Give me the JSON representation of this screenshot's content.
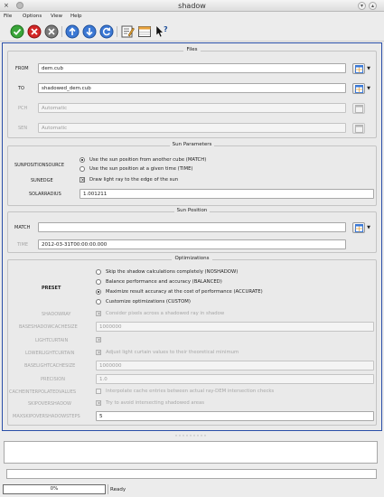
{
  "window": {
    "title": "shadow",
    "close_glyph": "×"
  },
  "menu": [
    "File",
    "Options",
    "View",
    "Help"
  ],
  "toolbar": {
    "icons": [
      "run-icon",
      "stop-icon",
      "reset-icon",
      "upload-icon",
      "download-icon",
      "refresh-icon",
      "edit-icon",
      "table-icon",
      "whats-this-icon"
    ]
  },
  "files": {
    "title": "Files",
    "rows": [
      {
        "label": "FROM",
        "value": "dem.cub",
        "enabled": true
      },
      {
        "label": "TO",
        "value": "shadowed_dem.cub",
        "enabled": true
      },
      {
        "label": "PCH",
        "value": "Automatic",
        "enabled": false
      },
      {
        "label": "SEN",
        "value": "Automatic",
        "enabled": false
      }
    ]
  },
  "sun_parameters": {
    "title": "Sun Parameters",
    "source_label": "SUNPOSITIONSOURCE",
    "source_options": [
      {
        "text": "Use the sun position from another cube (MATCH)",
        "selected": true
      },
      {
        "text": "Use the sun position at a given time (TIME)",
        "selected": false
      }
    ],
    "sunedge_label": "SUNEDGE",
    "sunedge_text": "Draw light ray to the edge of the sun",
    "sunedge_checked": true,
    "solarradius_label": "SOLARRADIUS",
    "solarradius_value": "1.001211"
  },
  "sun_position": {
    "title": "Sun Position",
    "match_label": "MATCH",
    "match_value": "",
    "time_label": "TIME",
    "time_value": "2012-03-31T00:00:00.000"
  },
  "optimizations": {
    "title": "Optimizations",
    "preset_label": "PRESET",
    "preset_options": [
      {
        "text": "Skip the shadow calculations completely (NOSHADOW)",
        "selected": false
      },
      {
        "text": "Balance performance and accuracy (BALANCED)",
        "selected": false
      },
      {
        "text": "Maximize result accuracy at the cost of performance (ACCURATE)",
        "selected": true
      },
      {
        "text": "Customize optimizations (CUSTOM)",
        "selected": false
      }
    ],
    "shadowray": {
      "label": "SHADOWRAY",
      "text": "Consider pixels across a shadowed ray in shadow",
      "checked": true
    },
    "basesize": {
      "label": "BASESHADOWCACHESIZE",
      "value": "1000000"
    },
    "lightcurtain": {
      "label": "LIGHTCURTAIN",
      "text": "",
      "checked": true
    },
    "lowerlight": {
      "label": "LOWERLIGHTCURTAIN",
      "text": "Adjust light curtain values to their theoretical minimum",
      "checked": true
    },
    "baselightcache": {
      "label": "BASELIGHTCACHESIZE",
      "value": "1000000"
    },
    "precision": {
      "label": "PRECISION",
      "value": "1.0"
    },
    "cacheinterp": {
      "label": "CACHEINTERPOLATEDVALUES",
      "text": "Interpolate cache entries between actual ray-DEM intersection checks",
      "checked": false
    },
    "skipovershadow": {
      "label": "SKIPOVERSHADOW",
      "text": "Try to avoid intersecting shadowed areas",
      "checked": true
    },
    "maxskip": {
      "label": "MAXSKIPOVERSHADOWSTEPS",
      "value": "5"
    }
  },
  "status": {
    "progress_value": 0,
    "progress_text": "0%",
    "message": "Ready"
  }
}
